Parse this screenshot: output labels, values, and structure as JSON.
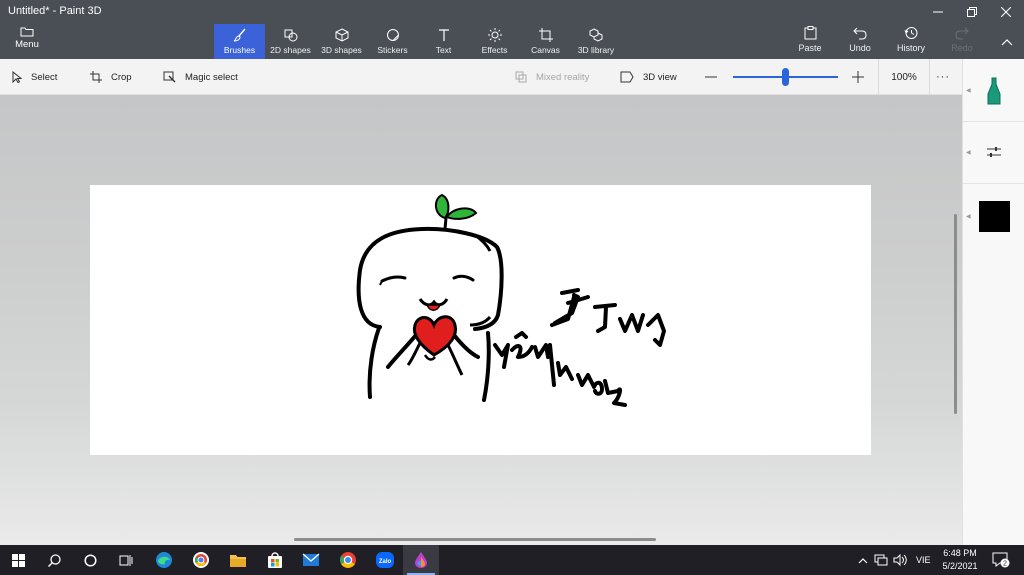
{
  "window": {
    "title": "Untitled* - Paint 3D",
    "controls": [
      "minimize-icon",
      "restore-icon",
      "close-icon"
    ]
  },
  "menu": {
    "label": "Menu",
    "icon": "folder-icon"
  },
  "ribbon": {
    "tabs": [
      {
        "label": "Brushes",
        "icon": "brush-icon",
        "active": true
      },
      {
        "label": "2D shapes",
        "icon": "2d-shapes-icon",
        "active": false
      },
      {
        "label": "3D shapes",
        "icon": "cube-icon",
        "active": false
      },
      {
        "label": "Stickers",
        "icon": "sticker-icon",
        "active": false
      },
      {
        "label": "Text",
        "icon": "text-icon",
        "active": false
      },
      {
        "label": "Effects",
        "icon": "sun-icon",
        "active": false
      },
      {
        "label": "Canvas",
        "icon": "canvas-icon",
        "active": false
      },
      {
        "label": "3D library",
        "icon": "3d-library-icon",
        "active": false
      }
    ],
    "paste": "Paste",
    "undo": "Undo",
    "history": "History",
    "redo": "Redo"
  },
  "subtoolbar": {
    "select": "Select",
    "crop": "Crop",
    "magic_select": "Magic select",
    "mixed_reality": "Mixed reality",
    "view_3d": "3D view",
    "zoom": "100%",
    "zoom_level": 0.5,
    "more": "···"
  },
  "drawing": {
    "handwriting": [
      "Hùng",
      "yêu Hương"
    ]
  },
  "right_panel": {
    "tool": "marker-icon",
    "settings": "sliders-icon",
    "color": "#000000"
  },
  "taskbar": {
    "apps": [
      "start-icon",
      "search-icon",
      "cortana-icon",
      "task-view-icon",
      "edge-icon",
      "chrome-icon",
      "file-explorer-icon",
      "store-icon",
      "mail-icon",
      "chrome-icon",
      "zalo-icon",
      "paint3d-icon"
    ],
    "zalo_label": "Zalo",
    "language": "VIE",
    "time": "6:48 PM",
    "date": "5/2/2021",
    "notifications": "2"
  },
  "colors": {
    "accent": "#3b62d8",
    "titlebar": "#4a4f55",
    "taskbar": "#1f1f25",
    "sprout": "#2fb53a",
    "heart": "#e01e1e",
    "marker": "#1a9a7a"
  }
}
